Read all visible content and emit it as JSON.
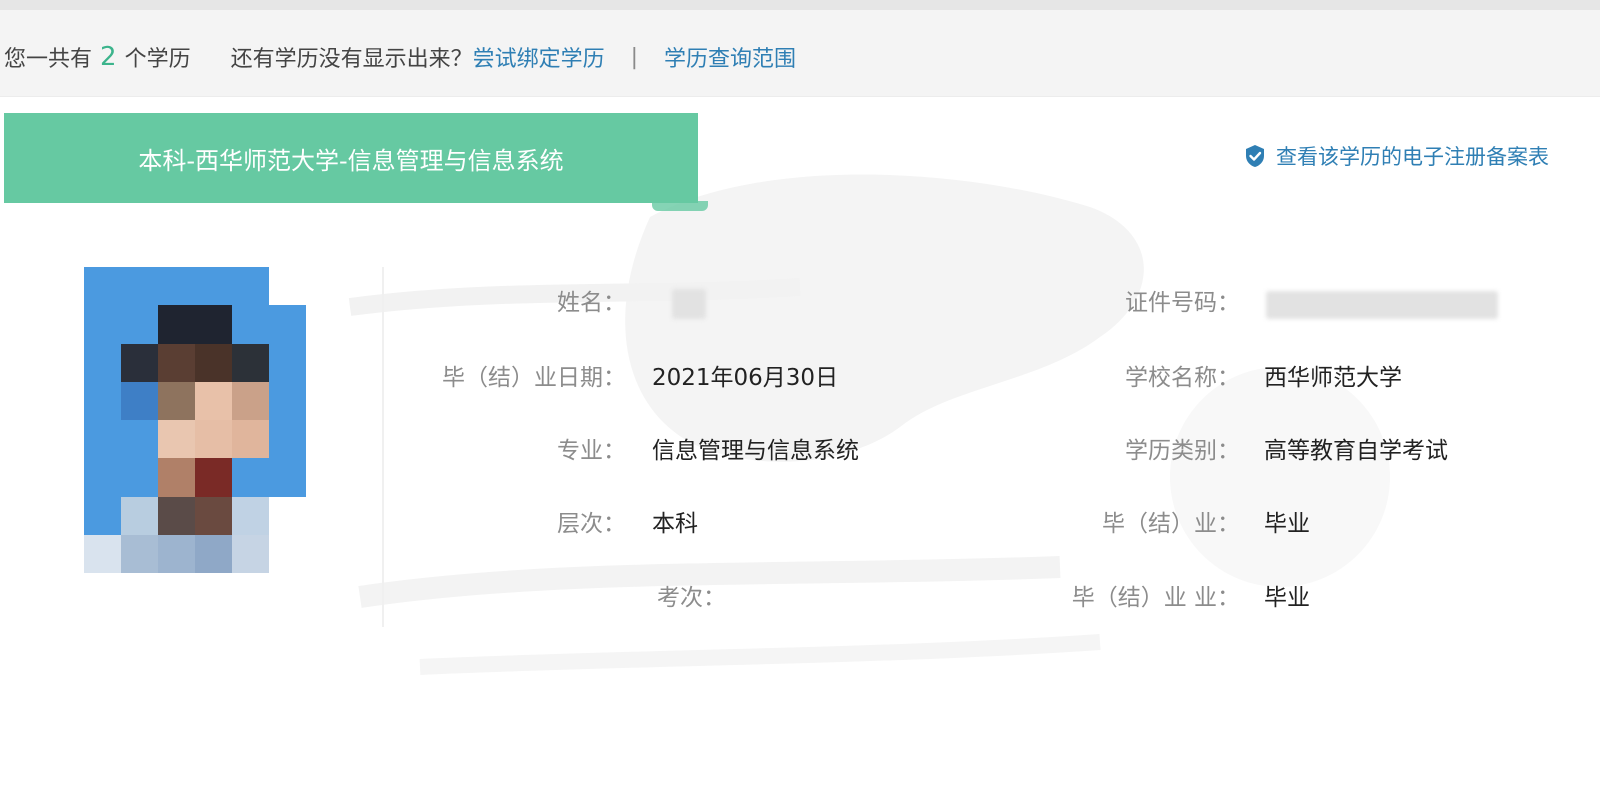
{
  "topbar": {
    "prefix": "您一共有",
    "count": "2",
    "suffix": "个学历",
    "question": "还有学历没有显示出来？",
    "bind_link": "尝试绑定学历",
    "separator": "|",
    "range_link": "学历查询范围"
  },
  "record": {
    "title": "本科-西华师范大学-信息管理与信息系统",
    "view_record_link": "查看该学历的电子注册备案表",
    "left_fields": [
      {
        "label": "姓名：",
        "value": ""
      },
      {
        "label": "毕（结）业日期：",
        "value": "2021年06月30日"
      },
      {
        "label": "专业：",
        "value": "信息管理与信息系统"
      },
      {
        "label": "层次：",
        "value": "本科"
      },
      {
        "label": "考次：",
        "value": ""
      }
    ],
    "right_fields": [
      {
        "label": "证件号码：",
        "value": ""
      },
      {
        "label": "学校名称：",
        "value": "西华师范大学"
      },
      {
        "label": "学历类别：",
        "value": "高等教育自学考试"
      },
      {
        "label": "毕（结）业：",
        "value": "毕业"
      },
      {
        "label": "毕（结）业 业：",
        "value": "毕业"
      }
    ]
  },
  "colors": {
    "tab_bg": "#66c9a2",
    "link": "#2f7fb4",
    "count": "#3cb48c",
    "label": "#8c8c8c"
  },
  "icons": {
    "record_link_icon": "shield-check-icon",
    "photo": "pixelated-avatar"
  }
}
